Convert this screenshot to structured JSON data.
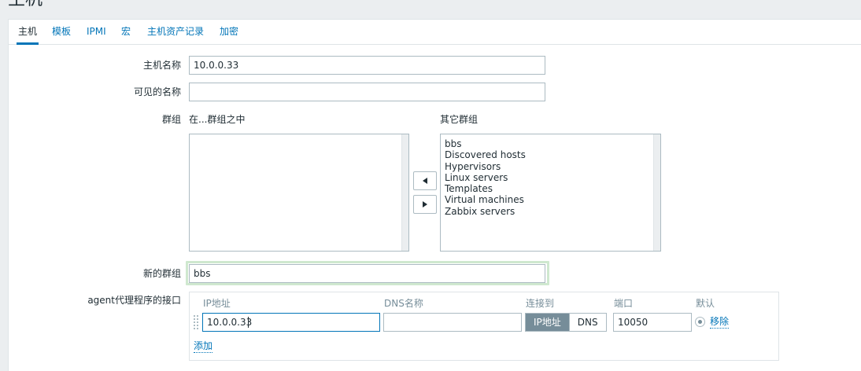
{
  "page": {
    "title": "主机"
  },
  "tabs": [
    {
      "label": "主机"
    },
    {
      "label": "模板"
    },
    {
      "label": "IPMI"
    },
    {
      "label": "宏"
    },
    {
      "label": "主机资产记录"
    },
    {
      "label": "加密"
    }
  ],
  "form": {
    "hostname": {
      "label": "主机名称",
      "value": "10.0.0.33"
    },
    "visible_name": {
      "label": "可见的名称",
      "value": ""
    },
    "groups": {
      "label": "群组",
      "in_groups_label": "在...群组之中",
      "other_groups_label": "其它群组",
      "in_groups": [],
      "other_groups": [
        "bbs",
        "Discovered hosts",
        "Hypervisors",
        "Linux servers",
        "Templates",
        "Virtual machines",
        "Zabbix servers"
      ]
    },
    "new_group": {
      "label": "新的群组",
      "value": "bbs"
    },
    "agent_interface": {
      "label": "agent代理程序的接口",
      "columns": {
        "ip": "IP地址",
        "dns": "DNS名称",
        "connect_to": "连接到",
        "port": "端口",
        "default": "默认"
      },
      "ip_value": "10.0.0.33",
      "dns_value": "",
      "connect_ip_label": "IP地址",
      "connect_dns_label": "DNS",
      "port_value": "10050",
      "remove_label": "移除",
      "add_label": "添加"
    }
  },
  "colors": {
    "accent": "#0275b8",
    "focus": "#cfe8cf",
    "segment_on": "#768d99"
  }
}
